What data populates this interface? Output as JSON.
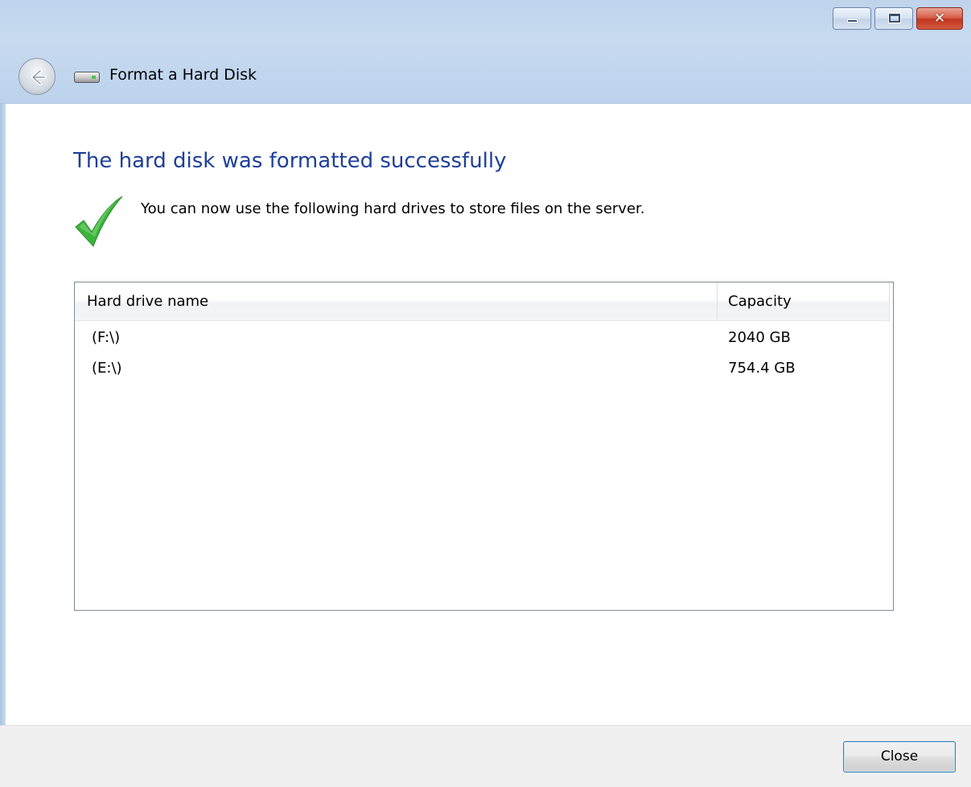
{
  "window": {
    "title": "Format a Hard Disk",
    "controls": [
      "minimize",
      "maximize",
      "close"
    ]
  },
  "content": {
    "heading": "The hard disk was formatted successfully",
    "description": "You can now use the following hard drives to store files on the server."
  },
  "drives_table": {
    "columns": [
      "Hard drive name",
      "Capacity"
    ],
    "rows": [
      {
        "name": "(F:\\)",
        "capacity": "2040 GB"
      },
      {
        "name": "(E:\\)",
        "capacity": "754.4 GB"
      }
    ]
  },
  "footer": {
    "close_label": "Close"
  },
  "colors": {
    "heading": "#1e3f9a",
    "titlebar": "#c7daf0",
    "success_check": "#3cb43c"
  }
}
